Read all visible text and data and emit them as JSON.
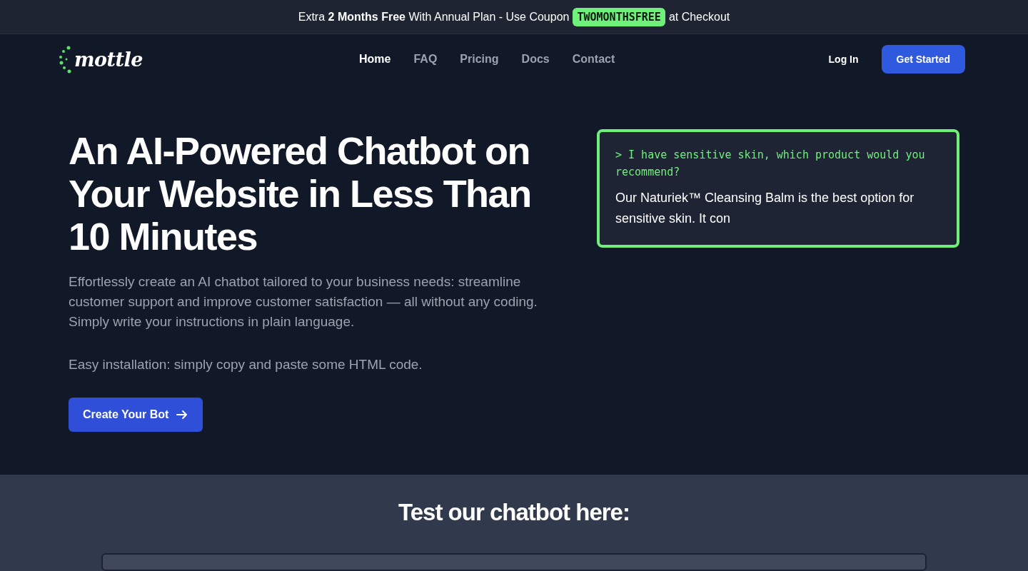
{
  "promo_bar": {
    "text_before": "Extra **2 Months Free** With Annual Plan - Use Coupon",
    "coupon": "TWOMONTHSFREE",
    "text_after": "at Checkout"
  },
  "nav": {
    "logo": "mottle",
    "links": [
      {
        "label": "Home",
        "selected": true
      },
      {
        "label": "FAQ",
        "selected": false
      },
      {
        "label": "Pricing",
        "selected": false
      },
      {
        "label": "Docs",
        "selected": false
      },
      {
        "label": "Contact",
        "selected": false
      }
    ],
    "login": "Log In",
    "cta": "Get Started"
  },
  "hero": {
    "heading": "An AI-Powered Chatbot on Your Website in Less Than 10 Minutes",
    "description": "Effortlessly create an AI chatbot tailored to your business needs: streamline customer support and improve customer satisfaction — all without any coding. Simply write your instructions in plain language.",
    "note": "Easy installation: simply copy and paste some HTML code.",
    "button": "Create Your Bot"
  },
  "demo": {
    "question": "> I have sensitive skin, which product would you recommend?",
    "answer": "Our Naturiek™ Cleansing Balm is the best option for sensitive skin. It con"
  },
  "test_section": {
    "heading": "Test our chatbot here:"
  }
}
